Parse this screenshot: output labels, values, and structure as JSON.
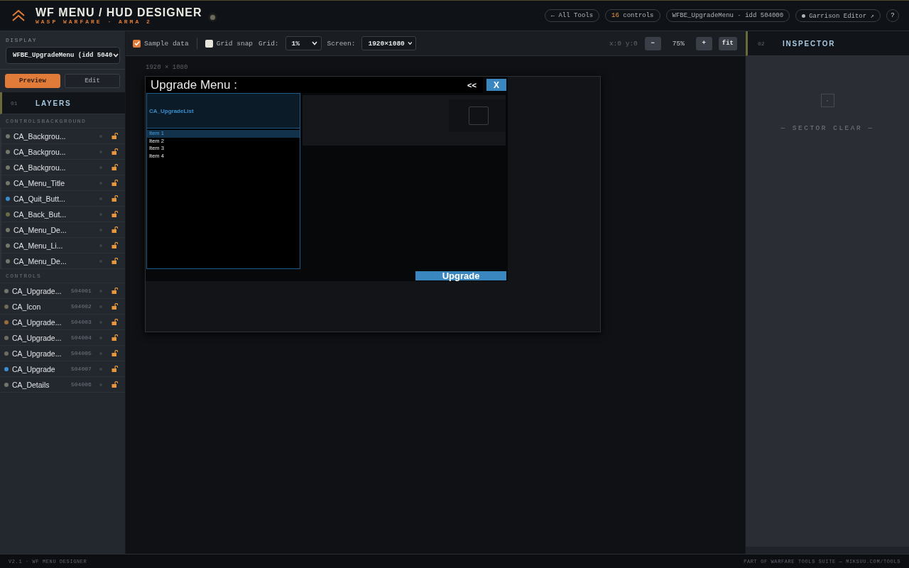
{
  "header": {
    "title": "WF MENU / HUD DESIGNER",
    "subtitle": "WASP WARFARE · ARMA 2",
    "pills": [
      {
        "kind": "link",
        "label": "← All Tools"
      },
      {
        "kind": "count",
        "value": "16",
        "label": "controls"
      },
      {
        "kind": "info",
        "label": "WFBE_UpgradeMenu · idd 504000"
      },
      {
        "kind": "external",
        "label": "Garrison Editor ↗"
      }
    ],
    "help": "?"
  },
  "sidebar": {
    "display_label": "DISPLAY",
    "display_select": "WFBE_UpgradeMenu (idd 5040",
    "modes": [
      {
        "label": "Preview",
        "selected": true
      },
      {
        "label": "Edit",
        "selected": false
      }
    ],
    "layers_panel": {
      "number": "01",
      "title": "LAYERS"
    },
    "groups": [
      {
        "title": "CONTROLSBACKGROUND",
        "layers": [
          {
            "name": "CA_Backgrou...",
            "color": "#75766a"
          },
          {
            "name": "CA_Backgrou...",
            "color": "#75766a"
          },
          {
            "name": "CA_Backgrou...",
            "color": "#75766a"
          },
          {
            "name": "CA_Menu_Title",
            "color": "#75766a"
          },
          {
            "name": "CA_Quit_Butt...",
            "color": "#3a8fd0"
          },
          {
            "name": "CA_Back_But...",
            "color": "#6b6a45"
          },
          {
            "name": "CA_Menu_De...",
            "color": "#75766a"
          },
          {
            "name": "CA_Menu_Li...",
            "color": "#75766a"
          },
          {
            "name": "CA_Menu_De...",
            "color": "#75766a"
          }
        ]
      },
      {
        "title": "CONTROLS",
        "layers": [
          {
            "name": "CA_Upgrade...",
            "idc": "504001",
            "color": "#75766a"
          },
          {
            "name": "CA_Icon",
            "idc": "504002",
            "color": "#6d6c55"
          },
          {
            "name": "CA_Upgrade...",
            "idc": "504003",
            "color": "#9a6c3a"
          },
          {
            "name": "CA_Upgrade...",
            "idc": "504004",
            "color": "#6d6d60"
          },
          {
            "name": "CA_Upgrade...",
            "idc": "504005",
            "color": "#6d6d60"
          },
          {
            "name": "CA_Upgrade",
            "idc": "504007",
            "color": "#3a8fd0"
          },
          {
            "name": "CA_Details",
            "idc": "504006",
            "color": "#75766a"
          }
        ]
      }
    ]
  },
  "toolbar": {
    "toggles": [
      {
        "label": "Sample data",
        "checked": true
      },
      {
        "label": "Grid snap",
        "checked": false
      }
    ],
    "selects": [
      {
        "label": "Grid:",
        "value": "1%"
      },
      {
        "label": "Screen:",
        "value": "1920×1080"
      }
    ],
    "cursor": "x:0 y:0",
    "zoom_out": "−",
    "zoom": "75%",
    "zoom_in": "+",
    "fit": "fit"
  },
  "canvas": {
    "size_label": "1920 × 1080",
    "dialog": {
      "title": "Upgrade Menu :",
      "back_button": "<<",
      "close_button": "X",
      "list": {
        "header": "CA_UpgradeList",
        "items": [
          {
            "label": "Item 1",
            "selected": true
          },
          {
            "label": "Item 2",
            "selected": false
          },
          {
            "label": "Item 3",
            "selected": false
          },
          {
            "label": "Item 4",
            "selected": false
          }
        ]
      },
      "action_button": "Upgrade"
    }
  },
  "inspector": {
    "number": "02",
    "title": "INSPECTOR",
    "empty_text": "— SECTOR CLEAR —"
  },
  "footer": {
    "left": "V2.1 · WF MENU DESIGNER",
    "right": "PART OF WARFARE TOOLS SUITE — MIKSUU.COM/TOOLS"
  }
}
